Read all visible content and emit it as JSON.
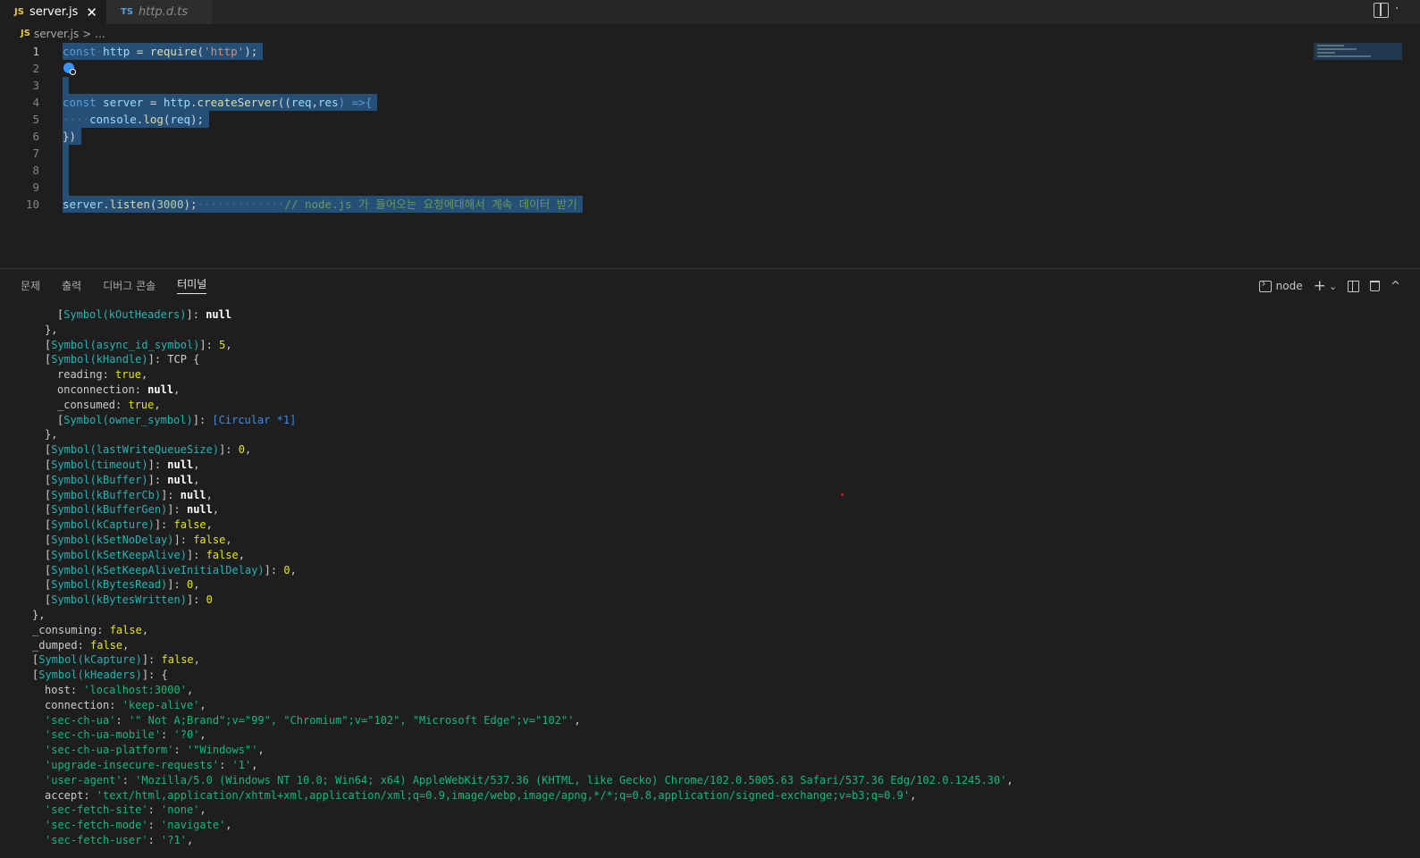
{
  "tabs": [
    {
      "lang": "JS",
      "name": "server.js",
      "close": "✕"
    },
    {
      "lang": "TS",
      "name": "http.d.ts"
    }
  ],
  "breadcrumb": {
    "lang": "JS",
    "file": "server.js",
    "sep": ">",
    "more": "..."
  },
  "editor": {
    "line_numbers": [
      "1",
      "2",
      "3",
      "4",
      "5",
      "6",
      "7",
      "8",
      "9",
      "10"
    ],
    "code": {
      "l1": {
        "kw": "const",
        "var": "http",
        "eq": " = ",
        "fn": "require",
        "open": "(",
        "str": "'http'",
        "close": ");"
      },
      "l4": {
        "kw": "const",
        "var": "server",
        "eq": " = ",
        "obj": "http",
        "dot": ".",
        "fn": "createServer",
        "args_open": "((",
        "p1": "req",
        "comma": ",",
        "p2": "res",
        "arrow": ") =>{"
      },
      "l5": {
        "indent": "····",
        "obj": "console",
        "dot": ".",
        "fn": "log",
        "open": "(",
        "arg": "req",
        "close": ");"
      },
      "l6": {
        "text": "})"
      },
      "l10": {
        "obj": "server",
        "dot": ".",
        "fn": "listen",
        "open": "(",
        "num": "3000",
        "close": ");",
        "dots": "·············",
        "comment": "// node.js 가 들어오는 요청에대해서 계속 데이터 받기"
      }
    }
  },
  "panel": {
    "tabs": [
      "문제",
      "출력",
      "디버그 콘솔",
      "터미널"
    ],
    "active_tab": "터미널",
    "terminal_name": "node",
    "add": "+",
    "chevron": "⌄",
    "trash": "🗑",
    "maximize": "^"
  },
  "terminal": {
    "lines": [
      {
        "indent": 64,
        "parts": [
          [
            "p",
            "["
          ],
          [
            "s",
            "Symbol(kOutHeaders)"
          ],
          [
            "p",
            "]: "
          ],
          [
            "n",
            "null"
          ]
        ]
      },
      {
        "indent": 50,
        "parts": [
          [
            "p",
            "},"
          ]
        ]
      },
      {
        "indent": 50,
        "parts": [
          [
            "p",
            "["
          ],
          [
            "s",
            "Symbol(async_id_symbol)"
          ],
          [
            "p",
            "]: "
          ],
          [
            "y",
            "5"
          ],
          [
            "p",
            ","
          ]
        ]
      },
      {
        "indent": 50,
        "parts": [
          [
            "p",
            "["
          ],
          [
            "s",
            "Symbol(kHandle)"
          ],
          [
            "p",
            "]: TCP {"
          ]
        ]
      },
      {
        "indent": 64,
        "parts": [
          [
            "p",
            "reading: "
          ],
          [
            "y",
            "true"
          ],
          [
            "p",
            ","
          ]
        ]
      },
      {
        "indent": 64,
        "parts": [
          [
            "p",
            "onconnection: "
          ],
          [
            "n",
            "null"
          ],
          [
            "p",
            ","
          ]
        ]
      },
      {
        "indent": 64,
        "parts": [
          [
            "p",
            "_consumed: "
          ],
          [
            "y",
            "true"
          ],
          [
            "p",
            ","
          ]
        ]
      },
      {
        "indent": 64,
        "parts": [
          [
            "p",
            "["
          ],
          [
            "s",
            "Symbol(owner_symbol)"
          ],
          [
            "p",
            "]: "
          ],
          [
            "c",
            "[Circular *1]"
          ]
        ]
      },
      {
        "indent": 50,
        "parts": [
          [
            "p",
            "},"
          ]
        ]
      },
      {
        "indent": 50,
        "parts": [
          [
            "p",
            "["
          ],
          [
            "s",
            "Symbol(lastWriteQueueSize)"
          ],
          [
            "p",
            "]: "
          ],
          [
            "y",
            "0"
          ],
          [
            "p",
            ","
          ]
        ]
      },
      {
        "indent": 50,
        "parts": [
          [
            "p",
            "["
          ],
          [
            "s",
            "Symbol(timeout)"
          ],
          [
            "p",
            "]: "
          ],
          [
            "n",
            "null"
          ],
          [
            "p",
            ","
          ]
        ]
      },
      {
        "indent": 50,
        "parts": [
          [
            "p",
            "["
          ],
          [
            "s",
            "Symbol(kBuffer)"
          ],
          [
            "p",
            "]: "
          ],
          [
            "n",
            "null"
          ],
          [
            "p",
            ","
          ]
        ]
      },
      {
        "indent": 50,
        "parts": [
          [
            "p",
            "["
          ],
          [
            "s",
            "Symbol(kBufferCb)"
          ],
          [
            "p",
            "]: "
          ],
          [
            "n",
            "null"
          ],
          [
            "p",
            ","
          ]
        ]
      },
      {
        "indent": 50,
        "parts": [
          [
            "p",
            "["
          ],
          [
            "s",
            "Symbol(kBufferGen)"
          ],
          [
            "p",
            "]: "
          ],
          [
            "n",
            "null"
          ],
          [
            "p",
            ","
          ]
        ]
      },
      {
        "indent": 50,
        "parts": [
          [
            "p",
            "["
          ],
          [
            "s",
            "Symbol(kCapture)"
          ],
          [
            "p",
            "]: "
          ],
          [
            "y",
            "false"
          ],
          [
            "p",
            ","
          ]
        ]
      },
      {
        "indent": 50,
        "parts": [
          [
            "p",
            "["
          ],
          [
            "s",
            "Symbol(kSetNoDelay)"
          ],
          [
            "p",
            "]: "
          ],
          [
            "y",
            "false"
          ],
          [
            "p",
            ","
          ]
        ]
      },
      {
        "indent": 50,
        "parts": [
          [
            "p",
            "["
          ],
          [
            "s",
            "Symbol(kSetKeepAlive)"
          ],
          [
            "p",
            "]: "
          ],
          [
            "y",
            "false"
          ],
          [
            "p",
            ","
          ]
        ]
      },
      {
        "indent": 50,
        "parts": [
          [
            "p",
            "["
          ],
          [
            "s",
            "Symbol(kSetKeepAliveInitialDelay)"
          ],
          [
            "p",
            "]: "
          ],
          [
            "y",
            "0"
          ],
          [
            "p",
            ","
          ]
        ]
      },
      {
        "indent": 50,
        "parts": [
          [
            "p",
            "["
          ],
          [
            "s",
            "Symbol(kBytesRead)"
          ],
          [
            "p",
            "]: "
          ],
          [
            "y",
            "0"
          ],
          [
            "p",
            ","
          ]
        ]
      },
      {
        "indent": 50,
        "parts": [
          [
            "p",
            "["
          ],
          [
            "s",
            "Symbol(kBytesWritten)"
          ],
          [
            "p",
            "]: "
          ],
          [
            "y",
            "0"
          ]
        ]
      },
      {
        "indent": 36,
        "parts": [
          [
            "p",
            "},"
          ]
        ]
      },
      {
        "indent": 36,
        "parts": [
          [
            "p",
            "_consuming: "
          ],
          [
            "y",
            "false"
          ],
          [
            "p",
            ","
          ]
        ]
      },
      {
        "indent": 36,
        "parts": [
          [
            "p",
            "_dumped: "
          ],
          [
            "y",
            "false"
          ],
          [
            "p",
            ","
          ]
        ]
      },
      {
        "indent": 36,
        "parts": [
          [
            "p",
            "["
          ],
          [
            "s",
            "Symbol(kCapture)"
          ],
          [
            "p",
            "]: "
          ],
          [
            "y",
            "false"
          ],
          [
            "p",
            ","
          ]
        ]
      },
      {
        "indent": 36,
        "parts": [
          [
            "p",
            "["
          ],
          [
            "s",
            "Symbol(kHeaders)"
          ],
          [
            "p",
            "]: {"
          ]
        ]
      },
      {
        "indent": 50,
        "parts": [
          [
            "p",
            "host: "
          ],
          [
            "g",
            "'localhost:3000'"
          ],
          [
            "p",
            ","
          ]
        ]
      },
      {
        "indent": 50,
        "parts": [
          [
            "p",
            "connection: "
          ],
          [
            "g",
            "'keep-alive'"
          ],
          [
            "p",
            ","
          ]
        ]
      },
      {
        "indent": 50,
        "parts": [
          [
            "g",
            "'sec-ch-ua'"
          ],
          [
            "p",
            ": "
          ],
          [
            "g",
            "'\" Not A;Brand\";v=\"99\", \"Chromium\";v=\"102\", \"Microsoft Edge\";v=\"102\"'"
          ],
          [
            "p",
            ","
          ]
        ]
      },
      {
        "indent": 50,
        "parts": [
          [
            "g",
            "'sec-ch-ua-mobile'"
          ],
          [
            "p",
            ": "
          ],
          [
            "g",
            "'?0'"
          ],
          [
            "p",
            ","
          ]
        ]
      },
      {
        "indent": 50,
        "parts": [
          [
            "g",
            "'sec-ch-ua-platform'"
          ],
          [
            "p",
            ": "
          ],
          [
            "g",
            "'\"Windows\"'"
          ],
          [
            "p",
            ","
          ]
        ]
      },
      {
        "indent": 50,
        "parts": [
          [
            "g",
            "'upgrade-insecure-requests'"
          ],
          [
            "p",
            ": "
          ],
          [
            "g",
            "'1'"
          ],
          [
            "p",
            ","
          ]
        ]
      },
      {
        "indent": 50,
        "parts": [
          [
            "g",
            "'user-agent'"
          ],
          [
            "p",
            ": "
          ],
          [
            "g",
            "'Mozilla/5.0 (Windows NT 10.0; Win64; x64) AppleWebKit/537.36 (KHTML, like Gecko) Chrome/102.0.5005.63 Safari/537.36 Edg/102.0.1245.30'"
          ],
          [
            "p",
            ","
          ]
        ]
      },
      {
        "indent": 50,
        "parts": [
          [
            "p",
            "accept: "
          ],
          [
            "g",
            "'text/html,application/xhtml+xml,application/xml;q=0.9,image/webp,image/apng,*/*;q=0.8,application/signed-exchange;v=b3;q=0.9'"
          ],
          [
            "p",
            ","
          ]
        ]
      },
      {
        "indent": 50,
        "parts": [
          [
            "g",
            "'sec-fetch-site'"
          ],
          [
            "p",
            ": "
          ],
          [
            "g",
            "'none'"
          ],
          [
            "p",
            ","
          ]
        ]
      },
      {
        "indent": 50,
        "parts": [
          [
            "g",
            "'sec-fetch-mode'"
          ],
          [
            "p",
            ": "
          ],
          [
            "g",
            "'navigate'"
          ],
          [
            "p",
            ","
          ]
        ]
      },
      {
        "indent": 50,
        "parts": [
          [
            "g",
            "'sec-fetch-user'"
          ],
          [
            "p",
            ": "
          ],
          [
            "g",
            "'?1'"
          ],
          [
            "p",
            ","
          ]
        ]
      }
    ]
  },
  "colors": {
    "editor_bg": "#1e1e1e",
    "selection": "#264f78",
    "symbol": "#23b4b4",
    "string": "#0dbc79",
    "yellow": "#e5e510"
  }
}
